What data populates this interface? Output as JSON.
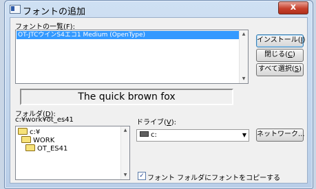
{
  "window": {
    "title": "フォントの追加",
    "close_label": "x"
  },
  "font_list": {
    "label_prefix": "フォントの一覧(",
    "label_key": "F",
    "label_suffix": "):",
    "items": [
      "OT-JTCウインS4エコ1 Medium (OpenType)"
    ]
  },
  "preview": {
    "text": "The quick brown fox"
  },
  "buttons": {
    "install": {
      "prefix": "インストール(",
      "key": "I",
      "suffix": ")"
    },
    "close": {
      "prefix": "閉じる(",
      "key": "C",
      "suffix": ")"
    },
    "select_all": {
      "prefix": "すべて選択(",
      "key": "S",
      "suffix": ")"
    },
    "network": "ネットワーク..."
  },
  "folder": {
    "label_prefix": "フォルダ(",
    "label_key": "D",
    "label_suffix": "):",
    "current_path": "c:¥work¥ot_es41",
    "tree": [
      "c:¥",
      "WORK",
      "OT_ES41"
    ]
  },
  "drive": {
    "label_prefix": "ドライブ(",
    "label_key": "V",
    "label_suffix": "):",
    "value": "c:"
  },
  "copy_option": {
    "label": "フォント フォルダにフォントをコピーする",
    "checked": true,
    "checkmark": "✓"
  }
}
